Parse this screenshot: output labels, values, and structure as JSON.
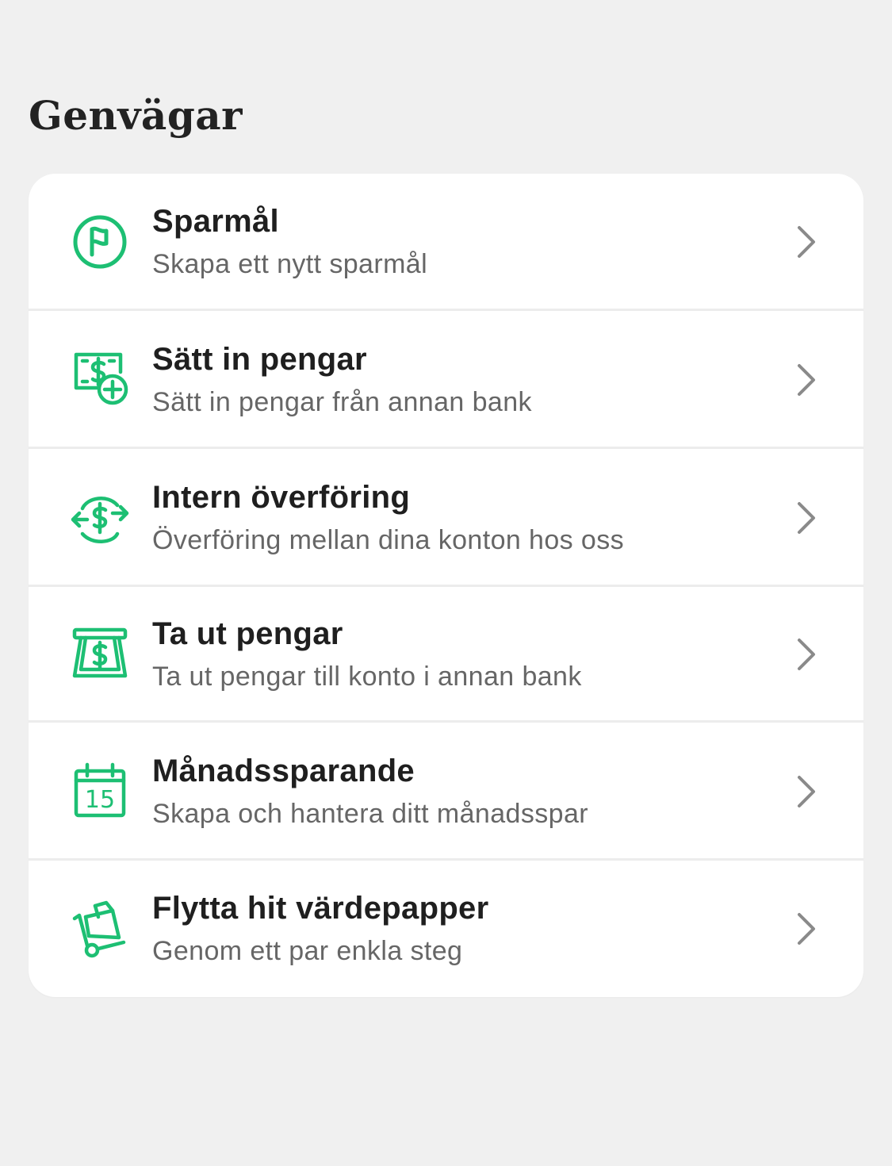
{
  "page": {
    "title": "Genvägar"
  },
  "colors": {
    "accent": "#1dbf73",
    "background": "#f0f0f0",
    "card": "#ffffff",
    "title_text": "#1f1f1f",
    "subtitle_text": "#666666",
    "chevron": "#8a8a8a"
  },
  "shortcuts": [
    {
      "icon": "savings-goal-flag-icon",
      "title": "Sparmål",
      "subtitle": "Skapa ett nytt sparmål"
    },
    {
      "icon": "deposit-money-icon",
      "title": "Sätt in pengar",
      "subtitle": "Sätt in pengar från annan bank"
    },
    {
      "icon": "internal-transfer-icon",
      "title": "Intern överföring",
      "subtitle": "Överföring mellan dina konton hos oss"
    },
    {
      "icon": "withdraw-money-icon",
      "title": "Ta ut pengar",
      "subtitle": "Ta ut pengar till konto i annan bank"
    },
    {
      "icon": "calendar-icon",
      "calendar_day": "15",
      "title": "Månadssparande",
      "subtitle": "Skapa och hantera ditt månadsspar"
    },
    {
      "icon": "move-securities-icon",
      "title": "Flytta hit värdepapper",
      "subtitle": "Genom ett par enkla steg"
    }
  ]
}
